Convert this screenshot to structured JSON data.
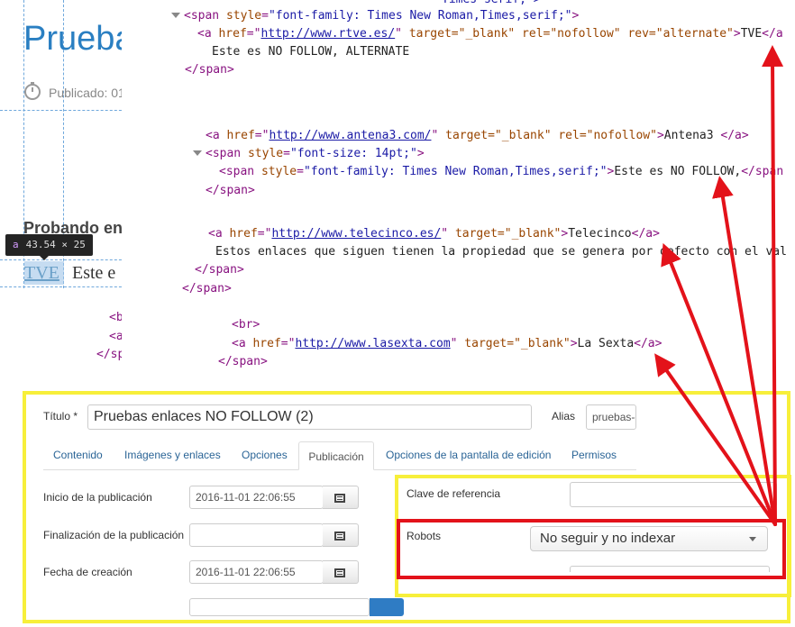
{
  "background_page": {
    "title": "Prueba",
    "published": "Publicado: 01",
    "heading": "Probando en",
    "tooltip_tag": "a",
    "tooltip_size": "43.54 × 25",
    "link_text": "TVE",
    "following_text": "Este e",
    "code_lines": [
      "<b",
      "<a",
      "</sp"
    ]
  },
  "code_panel": {
    "lines": [
      {
        "tag_open": "<span ",
        "attr": "style",
        "val": "\"font-family: Times New Roman,Times,serif;\"",
        "close": ">"
      },
      {
        "tag_open": "<a ",
        "href_attr": "href",
        "href_val": "http://www.rtve.es/",
        "rest": " target=\"_blank\" rel=\"nofollow\" rev=\"alternate\"",
        "text": "TVE",
        "tag_close": "</a"
      },
      {
        "text": "Este es NO FOLLOW, ALTERNATE"
      },
      {
        "tag": "</span>"
      },
      {
        "tag_open": "<a ",
        "href_attr": "href",
        "href_val": "http://www.antena3.com/",
        "rest": " target=\"_blank\" rel=\"nofollow\"",
        "text": "Antena3 ",
        "tag_close": "</a>"
      },
      {
        "tag_open": "<span ",
        "attr": "style",
        "val": "\"font-size: 14pt;\"",
        "close": ">"
      },
      {
        "tag_open": "<span ",
        "attr": "style",
        "val": "\"font-family: Times New Roman,Times,serif;\"",
        "text": "Este es NO FOLLOW,",
        "tag_close": "</span"
      },
      {
        "tag": "</span>"
      },
      {
        "tag_open": "<a ",
        "href_attr": "href",
        "href_val": "http://www.telecinco.es/",
        "rest": " target=\"_blank\"",
        "text": "Telecinco",
        "tag_close": "</a>"
      },
      {
        "text": "Estos enlaces que siguen tienen la propiedad que se genera por defecto con el val"
      },
      {
        "tag": "</span>"
      },
      {
        "tag": "</span>"
      },
      {
        "tag": "<br>"
      },
      {
        "tag_open": "<a ",
        "href_attr": "href",
        "href_val": "http://www.lasexta.com",
        "rest": " target=\"_blank\"",
        "text": "La Sexta",
        "tag_close": "</a>"
      },
      {
        "tag": "</span>"
      }
    ],
    "partial_top": "Times serif;\">"
  },
  "admin": {
    "title_label": "Título *",
    "title_value": "Pruebas enlaces NO FOLLOW (2)",
    "alias_label": "Alias",
    "alias_value": "pruebas-e",
    "tabs": [
      "Contenido",
      "Imágenes y enlaces",
      "Opciones",
      "Publicación",
      "Opciones de la pantalla de edición",
      "Permisos"
    ],
    "fields": [
      {
        "label": "Inicio de la publicación",
        "value": "2016-11-01 22:06:55"
      },
      {
        "label": "Finalización de la publicación",
        "value": ""
      },
      {
        "label": "Fecha de creación",
        "value": "2016-11-01 22:06:55"
      }
    ],
    "metakey_label": "Clave de referencia",
    "robots_label": "Robots",
    "robots_value": "No seguir y no indexar"
  },
  "colors": {
    "highlight_yellow": "#f7ef3a",
    "highlight_red": "#e3121a",
    "link_blue": "#2a7fc2"
  }
}
